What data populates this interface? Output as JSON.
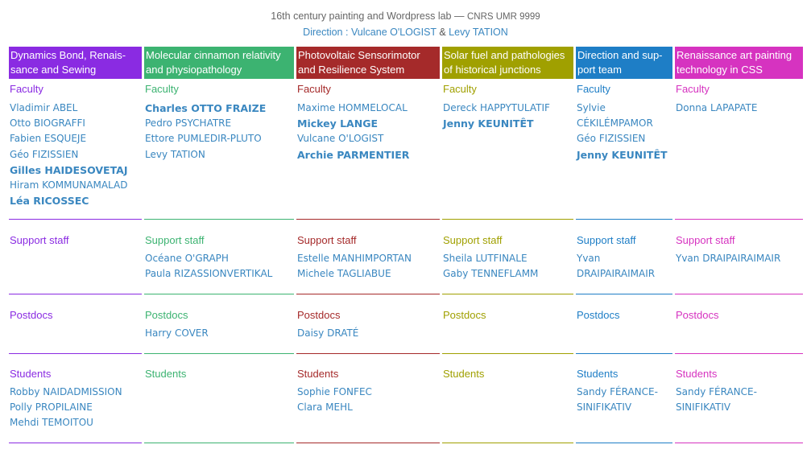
{
  "header": {
    "title": "16th century painting and Wordpress lab —",
    "title_unit": "CNRS UMR 9999",
    "direction_label": "Direction :",
    "director1": "Vulcane O'LOGIST",
    "ampersand": "&",
    "director2": "Levy TATION"
  },
  "colors": {
    "dynamics": "#8a2be2",
    "molecular": "#3cb371",
    "photovoltaic": "#a52a2a",
    "solar": "#a0a000",
    "direction": "#1e7ec6",
    "renaissance": "#d633c0",
    "link": "#3a87c0"
  },
  "teams": [
    {
      "title_line1": "Dynamics Bond, Renais-",
      "title_line2": "sance and Sewing",
      "faculty_label": "Faculty",
      "faculty": [
        "Vladimir ABEL",
        "Otto BIOGRAFFI",
        "Fabien ESQUEJE",
        "Géo FIZISSIEN",
        "Gilles HAIDESOVETAJ",
        "Hiram KOMMUNAMALAD",
        "Léa RICOSSEC"
      ],
      "support_label": "Support staff",
      "support": [],
      "postdocs_label": "Postdocs",
      "postdocs": [],
      "students_label": "Students",
      "students": [
        "Robby NAIDADMISSION",
        "Polly PROPILAINE",
        "Mehdi TEMOITOU"
      ]
    },
    {
      "title_line1": "Molecular cinnamon relativity",
      "title_line2": "and physiopathology",
      "faculty_label": "Faculty",
      "faculty": [
        "Charles OTTO FRAIZE",
        "Pedro PSYCHATRE",
        "Ettore PUMLEDIR-PLUTO",
        "Levy TATION"
      ],
      "support_label": "Support staff",
      "support": [
        "Océane O'GRAPH",
        "Paula RIZASSIONVERTIKAL"
      ],
      "postdocs_label": "Postdocs",
      "postdocs": [
        "Harry COVER"
      ],
      "students_label": "Students",
      "students": []
    },
    {
      "title_line1": "Photovoltaic Sensorimotor",
      "title_line2": "and Resilience System",
      "faculty_label": "Faculty",
      "faculty": [
        "Maxime HOMMELOCAL",
        "Mickey LANGE",
        "Vulcane O'LOGIST",
        "Archie PARMENTIER"
      ],
      "support_label": "Support staff",
      "support": [
        "Estelle MANHIMPORTAN",
        "Michele TAGLIABUE"
      ],
      "postdocs_label": "Postdocs",
      "postdocs": [
        "Daisy DRATÉ"
      ],
      "students_label": "Students",
      "students": [
        "Sophie FONFEC",
        "Clara MEHL"
      ]
    },
    {
      "title_line1": "Solar fuel and pathologies",
      "title_line2": "of historical junctions",
      "faculty_label": "Faculty",
      "faculty": [
        "Dereck HAPPYTULATIF",
        "Jenny KEUNITÊT"
      ],
      "support_label": "Support staff",
      "support": [
        "Sheila LUTFINALE",
        "Gaby TENNEFLAMM"
      ],
      "postdocs_label": "Postdocs",
      "postdocs": [],
      "students_label": "Students",
      "students": []
    },
    {
      "title_line1": "Direction and sup-",
      "title_line2": "port team",
      "faculty_label": "Faculty",
      "faculty": [
        "Sylvie",
        "CÉKILÉMPAMOR",
        "Géo FIZISSIEN",
        "Jenny KEUNITÊT"
      ],
      "support_label": "Support staff",
      "support": [
        "Yvan",
        "DRAIPAIRAIMAIR"
      ],
      "postdocs_label": "Postdocs",
      "postdocs": [],
      "students_label": "Students",
      "students": [
        "Sandy FÉRANCE-",
        "SINIFIKATIV"
      ]
    },
    {
      "title_line1": "Renaissance art painting",
      "title_line2": "technology in CSS",
      "faculty_label": "Faculty",
      "faculty": [
        "Donna LAPAPATE"
      ],
      "support_label": "Support staff",
      "support": [
        "Yvan DRAIPAIRAIMAIR"
      ],
      "postdocs_label": "Postdocs",
      "postdocs": [],
      "students_label": "Students",
      "students": [
        "Sandy FÉRANCE-",
        "SINIFIKATIV"
      ]
    }
  ]
}
